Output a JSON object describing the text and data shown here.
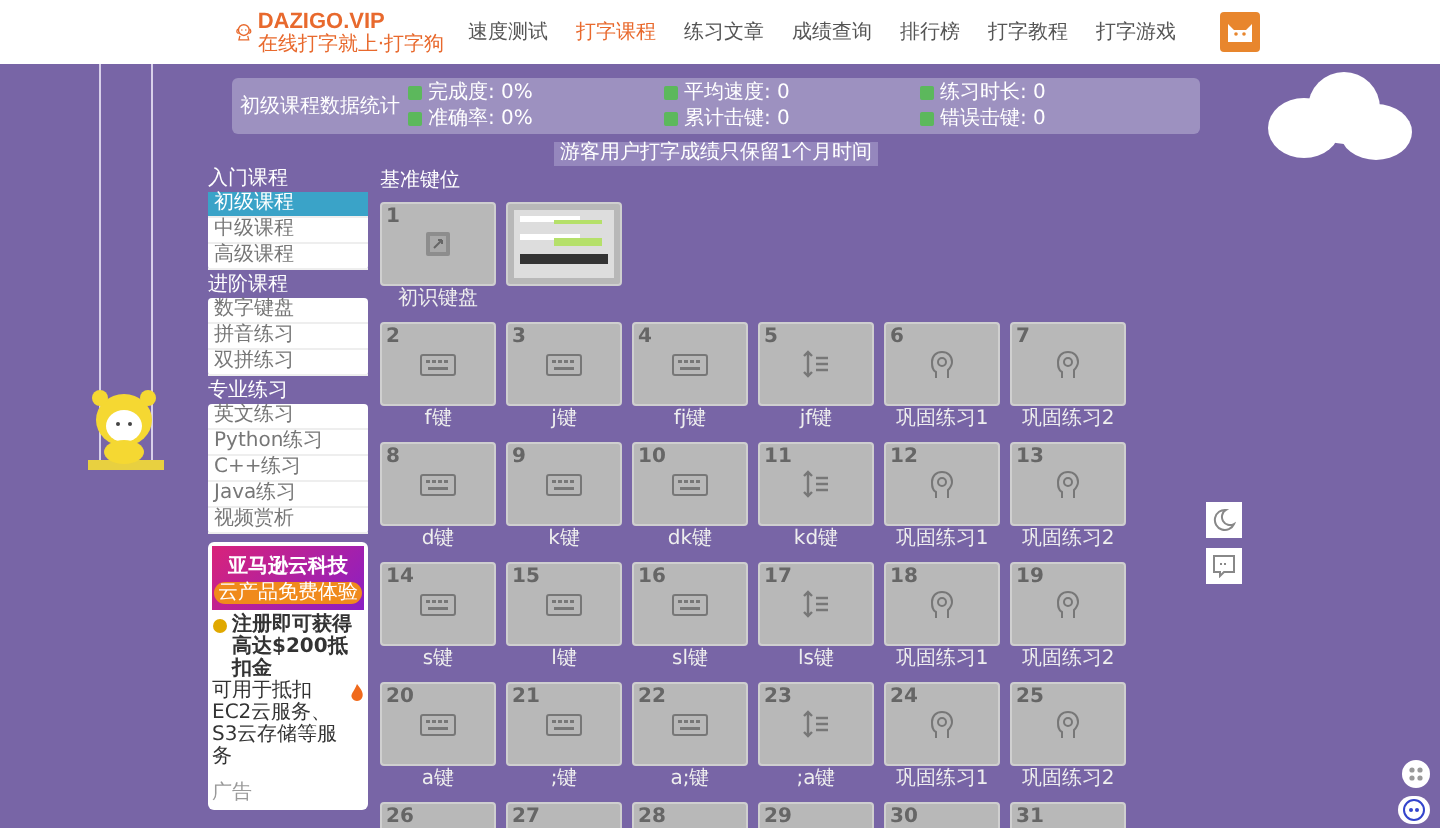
{
  "header": {
    "logo": {
      "name": "DAZIGO.VIP",
      "slogan": "在线打字就上·打字狗"
    },
    "nav": [
      {
        "label": "速度测试",
        "selected": false
      },
      {
        "label": "打字课程",
        "selected": true
      },
      {
        "label": "练习文章",
        "selected": false
      },
      {
        "label": "成绩查询",
        "selected": false
      },
      {
        "label": "排行榜",
        "selected": false
      },
      {
        "label": "打字教程",
        "selected": false
      },
      {
        "label": "打字游戏",
        "selected": false
      }
    ]
  },
  "stats": {
    "title": "初级课程数据统计",
    "items": [
      "完成度: 0%",
      "平均速度: 0",
      "练习时长: 0",
      "准确率: 0%",
      "累计击键: 0",
      "错误击键: 0"
    ]
  },
  "notice": "游客用户打字成绩只保留1个月时间",
  "sidebar": {
    "groups": [
      {
        "title": "入门课程",
        "items": [
          {
            "label": "初级课程",
            "selected": true
          },
          {
            "label": "中级课程",
            "selected": false
          },
          {
            "label": "高级课程",
            "selected": false
          }
        ]
      },
      {
        "title": "进阶课程",
        "items": [
          {
            "label": "数字键盘",
            "selected": false
          },
          {
            "label": "拼音练习",
            "selected": false
          },
          {
            "label": "双拼练习",
            "selected": false
          }
        ]
      },
      {
        "title": "专业练习",
        "items": [
          {
            "label": "英文练习",
            "selected": false
          },
          {
            "label": "Python练习",
            "selected": false
          },
          {
            "label": "C++练习",
            "selected": false
          },
          {
            "label": "Java练习",
            "selected": false
          },
          {
            "label": "视频赏析",
            "selected": false
          }
        ]
      }
    ],
    "ad": {
      "brand": "亚马逊云科技",
      "button": "云产品免费体验",
      "headline": "注册即可获得高达$200抵扣金",
      "body": "可用于抵扣EC2云服务、S3云存储等服务",
      "footer": "广告"
    }
  },
  "section_title": "基准键位",
  "lesson_rows": [
    [
      {
        "kind": "image",
        "number": "1",
        "label": "初识键盘"
      },
      {
        "kind": "preview"
      }
    ],
    [
      {
        "kind": "keyboard",
        "number": "2",
        "label": "f键"
      },
      {
        "kind": "keyboard",
        "number": "3",
        "label": "j键"
      },
      {
        "kind": "keyboard",
        "number": "4",
        "label": "fj键"
      },
      {
        "kind": "lines",
        "number": "5",
        "label": "jf键"
      },
      {
        "kind": "head",
        "number": "6",
        "label": "巩固练习1"
      },
      {
        "kind": "head",
        "number": "7",
        "label": "巩固练习2"
      }
    ],
    [
      {
        "kind": "keyboard",
        "number": "8",
        "label": "d键"
      },
      {
        "kind": "keyboard",
        "number": "9",
        "label": "k键"
      },
      {
        "kind": "keyboard",
        "number": "10",
        "label": "dk键"
      },
      {
        "kind": "lines",
        "number": "11",
        "label": "kd键"
      },
      {
        "kind": "head",
        "number": "12",
        "label": "巩固练习1"
      },
      {
        "kind": "head",
        "number": "13",
        "label": "巩固练习2"
      }
    ],
    [
      {
        "kind": "keyboard",
        "number": "14",
        "label": "s键"
      },
      {
        "kind": "keyboard",
        "number": "15",
        "label": "l键"
      },
      {
        "kind": "keyboard",
        "number": "16",
        "label": "sl键"
      },
      {
        "kind": "lines",
        "number": "17",
        "label": "ls键"
      },
      {
        "kind": "head",
        "number": "18",
        "label": "巩固练习1"
      },
      {
        "kind": "head",
        "number": "19",
        "label": "巩固练习2"
      }
    ],
    [
      {
        "kind": "keyboard",
        "number": "20",
        "label": "a键"
      },
      {
        "kind": "keyboard",
        "number": "21",
        "label": ";键"
      },
      {
        "kind": "keyboard",
        "number": "22",
        "label": "a;键"
      },
      {
        "kind": "lines",
        "number": "23",
        "label": ";a键"
      },
      {
        "kind": "head",
        "number": "24",
        "label": "巩固练习1"
      },
      {
        "kind": "head",
        "number": "25",
        "label": "巩固练习2"
      }
    ],
    [
      {
        "kind": "blank",
        "number": "26"
      },
      {
        "kind": "blank",
        "number": "27"
      },
      {
        "kind": "blank",
        "number": "28"
      },
      {
        "kind": "blank",
        "number": "29"
      },
      {
        "kind": "blank",
        "number": "30"
      },
      {
        "kind": "blank",
        "number": "31"
      }
    ]
  ]
}
